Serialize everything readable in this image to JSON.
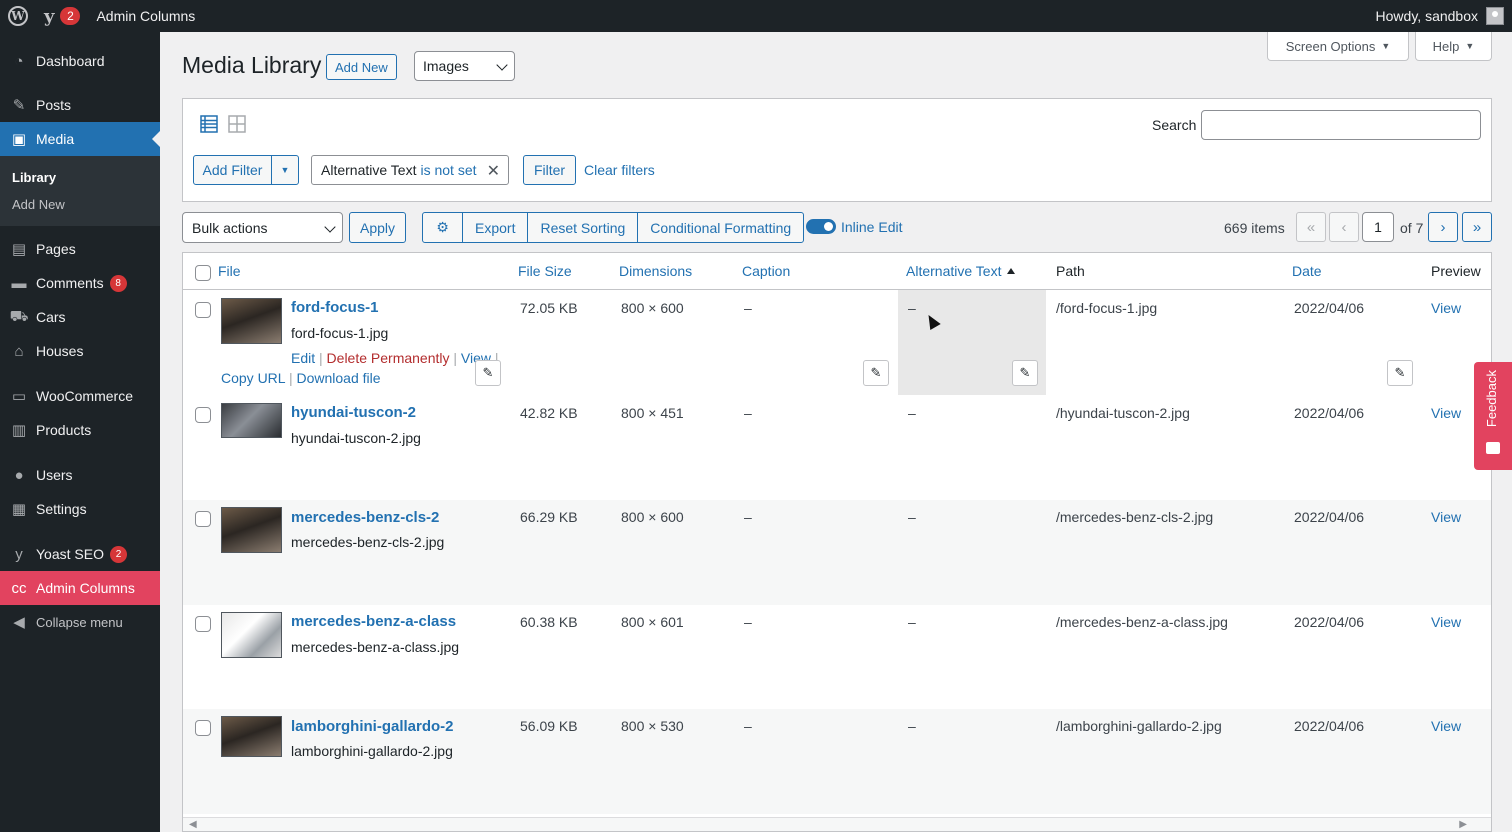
{
  "adminbar": {
    "comments_count": "2",
    "site_name": "Admin Columns",
    "howdy": "Howdy, sandbox"
  },
  "menu": {
    "dashboard": "Dashboard",
    "posts": "Posts",
    "media": "Media",
    "media_sub": [
      "Library",
      "Add New"
    ],
    "pages": "Pages",
    "comments": "Comments",
    "comments_count": "8",
    "cars": "Cars",
    "houses": "Houses",
    "woocommerce": "WooCommerce",
    "products": "Products",
    "users": "Users",
    "settings": "Settings",
    "yoast": "Yoast SEO",
    "yoast_count": "2",
    "admin_columns": "Admin Columns",
    "collapse": "Collapse menu"
  },
  "screen_meta": {
    "screen_options": "Screen Options",
    "help": "Help"
  },
  "header": {
    "title": "Media Library",
    "add_new": "Add New",
    "type_filter": "Images"
  },
  "filters": {
    "search_label": "Search",
    "search_value": "",
    "add_filter": "Add Filter",
    "chip_field": "Alternative Text",
    "chip_operator": "is not set",
    "filter_button": "Filter",
    "clear_filters": "Clear filters"
  },
  "tablenav": {
    "bulk_actions": "Bulk actions",
    "apply": "Apply",
    "export": "Export",
    "reset_sorting": "Reset Sorting",
    "conditional_formatting": "Conditional Formatting",
    "inline_edit": "Inline Edit",
    "items_count": "669 items",
    "first": "«",
    "prev": "‹",
    "current_page": "1",
    "of_pages": "of 7",
    "next": "›",
    "last": "»"
  },
  "columns": {
    "file": "File",
    "file_size": "File Size",
    "dimensions": "Dimensions",
    "caption": "Caption",
    "alt_text": "Alternative Text",
    "path": "Path",
    "date": "Date",
    "preview": "Preview"
  },
  "row_actions": {
    "edit": "Edit",
    "delete": "Delete Permanently",
    "view": "View",
    "copy_url": "Copy URL",
    "download": "Download file"
  },
  "rows": [
    {
      "title": "ford-focus-1",
      "filename": "ford-focus-1.jpg",
      "size": "72.05 KB",
      "dimensions": "800 × 600",
      "caption": "–",
      "alt": "–",
      "path": "/ford-focus-1.jpg",
      "date": "2022/04/06",
      "view": "View"
    },
    {
      "title": "hyundai-tuscon-2",
      "filename": "hyundai-tuscon-2.jpg",
      "size": "42.82 KB",
      "dimensions": "800 × 451",
      "caption": "–",
      "alt": "–",
      "path": "/hyundai-tuscon-2.jpg",
      "date": "2022/04/06",
      "view": "View"
    },
    {
      "title": "mercedes-benz-cls-2",
      "filename": "mercedes-benz-cls-2.jpg",
      "size": "66.29 KB",
      "dimensions": "800 × 600",
      "caption": "–",
      "alt": "–",
      "path": "/mercedes-benz-cls-2.jpg",
      "date": "2022/04/06",
      "view": "View"
    },
    {
      "title": "mercedes-benz-a-class",
      "filename": "mercedes-benz-a-class.jpg",
      "size": "60.38 KB",
      "dimensions": "800 × 601",
      "caption": "–",
      "alt": "–",
      "path": "/mercedes-benz-a-class.jpg",
      "date": "2022/04/06",
      "view": "View"
    },
    {
      "title": "lamborghini-gallardo-2",
      "filename": "lamborghini-gallardo-2.jpg",
      "size": "56.09 KB",
      "dimensions": "800 × 530",
      "caption": "–",
      "alt": "–",
      "path": "/lamborghini-gallardo-2.jpg",
      "date": "2022/04/06",
      "view": "View"
    }
  ],
  "feedback": "Feedback",
  "colors": {
    "accent": "#2271b1",
    "admin_columns": "#e2435f",
    "sidebar": "#1d2327"
  }
}
